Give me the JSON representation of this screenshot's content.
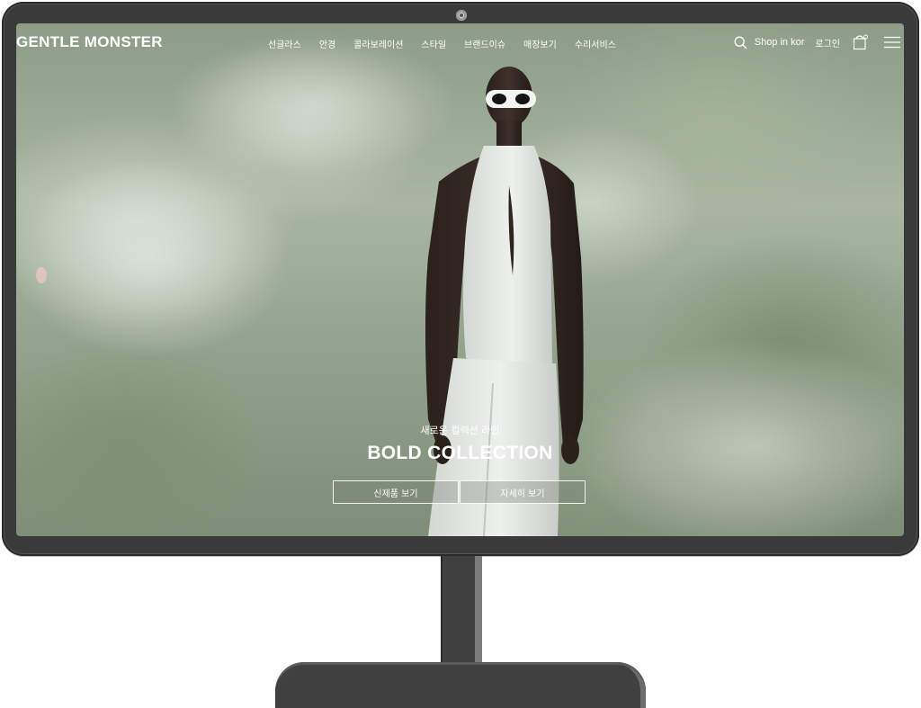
{
  "brand": {
    "logo_text": "GENTLE MONSTER"
  },
  "nav": {
    "menu_items": [
      {
        "label": "선글라스"
      },
      {
        "label": "안경"
      },
      {
        "label": "콜라보레이션"
      },
      {
        "label": "스타일"
      },
      {
        "label": "브랜드이슈"
      },
      {
        "label": "매장보기"
      },
      {
        "label": "수리서비스"
      }
    ],
    "shop_region": "Shop in kor",
    "login": "로그인",
    "icons": {
      "search": "search-icon",
      "cart": "shopping-bag-icon",
      "menu": "hamburger-menu-icon"
    }
  },
  "hero": {
    "subtitle": "새로운 컬렉션 라인",
    "title": "BOLD COLLECTION",
    "buttons": {
      "new_products": "신제품 보기",
      "learn_more": "자세히 보기"
    }
  },
  "colors": {
    "nav_text": "#ffffff",
    "bezel": "#3a3a3a",
    "backdrop": "#8c9c86"
  }
}
